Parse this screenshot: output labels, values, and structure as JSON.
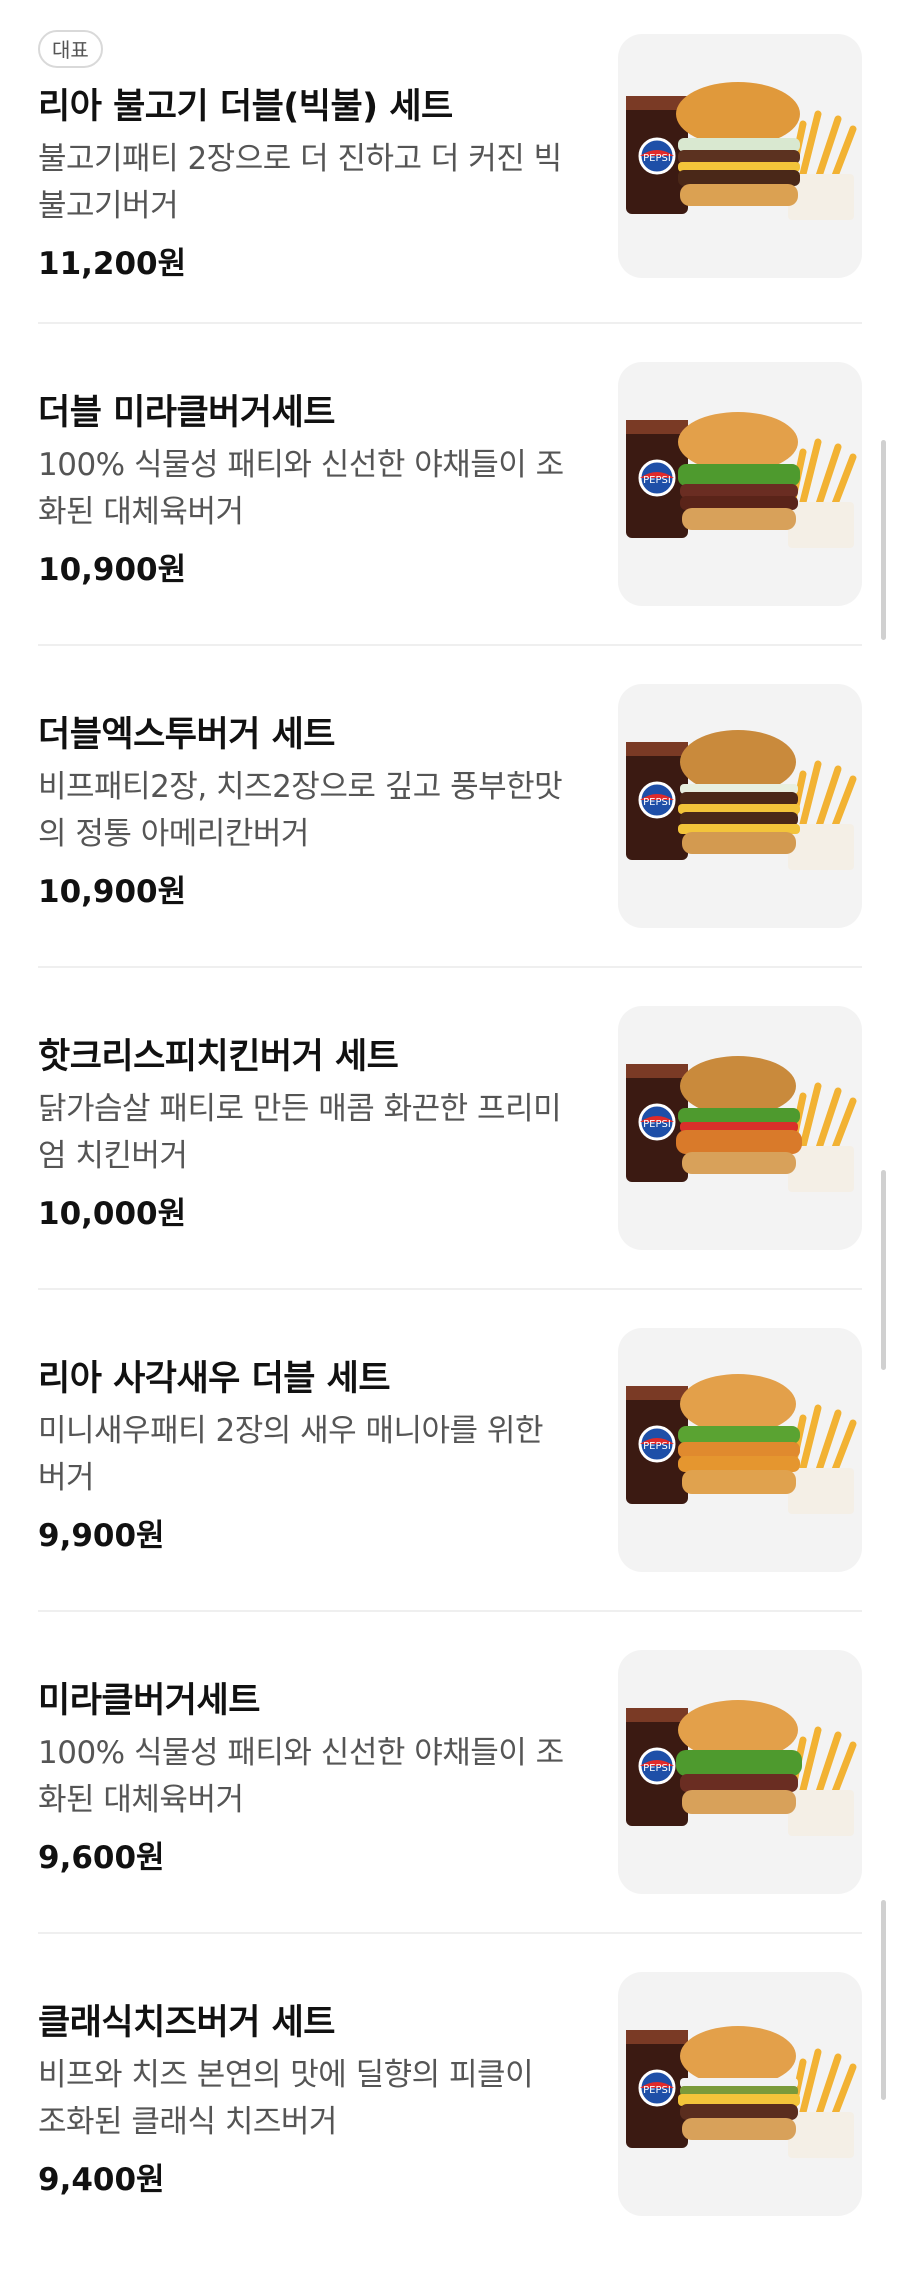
{
  "badge": "대표",
  "items": [
    {
      "name": "리아 불고기 더블(빅불) 세트",
      "desc": "불고기패티 2장으로 더 진하고 더 커진 빅불고기버거",
      "desc_lines": [
        "불고기패티 2장으로 더 진하고 더 커진 빅",
        "불고기버거"
      ],
      "price": "11,200원",
      "burger": "bulgogi"
    },
    {
      "name": "더블 미라클버거세트",
      "desc": "100% 식물성 패티와 신선한 야채들이 조화된 대체육버거",
      "desc_lines": [
        "100% 식물성 패티와 신선한 야채들이 조",
        "화된 대체육버거"
      ],
      "price": "10,900원",
      "burger": "miracle-double"
    },
    {
      "name": "더블엑스투버거 세트",
      "desc": "비프패티2장, 치즈2장으로 깊고 풍부한맛의 정통 아메리칸버거",
      "desc_lines": [
        "비프패티2장, 치즈2장으로 깊고 풍부한맛",
        "의 정통 아메리칸버거"
      ],
      "price": "10,900원",
      "burger": "x2"
    },
    {
      "name": "핫크리스피치킨버거 세트",
      "desc": "닭가슴살 패티로 만든 매콤 화끈한 프리미엄 치킨버거",
      "desc_lines": [
        "닭가슴살 패티로 만든 매콤 화끈한 프리미",
        "엄 치킨버거"
      ],
      "price": "10,000원",
      "burger": "chicken"
    },
    {
      "name": "리아 사각새우 더블 세트",
      "desc": "미니새우패티 2장의 새우 매니아를 위한 버거",
      "desc_lines": [
        "미니새우패티 2장의 새우 매니아를 위한",
        "버거"
      ],
      "price": "9,900원",
      "burger": "shrimp"
    },
    {
      "name": "미라클버거세트",
      "desc": "100% 식물성 패티와 신선한 야채들이 조화된 대체육버거",
      "desc_lines": [
        "100% 식물성 패티와 신선한 야채들이 조",
        "화된 대체육버거"
      ],
      "price": "9,600원",
      "burger": "miracle"
    },
    {
      "name": "클래식치즈버거 세트",
      "desc": "비프와 치즈 본연의 맛에 딜향의 피클이 조화된 클래식 치즈버거",
      "desc_lines": [
        "비프와 치즈 본연의 맛에 딜향의 피클이",
        "조화된 클래식 치즈버거"
      ],
      "price": "9,400원",
      "burger": "cheese"
    }
  ],
  "drink_label": "PEPSI",
  "colors": {
    "text": "#111111",
    "desc": "#555555",
    "card_bg": "#f3f3f3",
    "divider": "#efefef"
  }
}
